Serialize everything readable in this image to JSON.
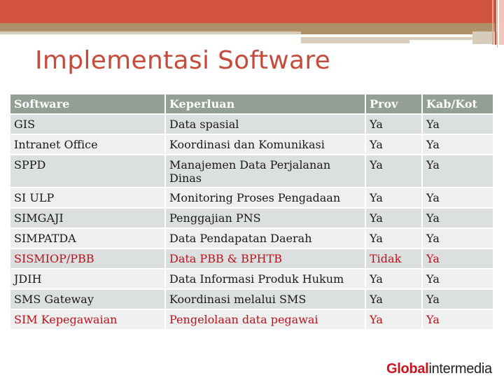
{
  "slide": {
    "title": "Implementasi Software",
    "accent_color": "#d2533d",
    "band_color": "#ae9169"
  },
  "table": {
    "columns": [
      "Software",
      "Keperluan",
      "Prov",
      "Kab/Kot"
    ],
    "rows": [
      {
        "software": "GIS",
        "keperluan": "Data spasial",
        "prov": "Ya",
        "kab": "Ya",
        "highlight": false
      },
      {
        "software": "Intranet Office",
        "keperluan": "Koordinasi dan Komunikasi",
        "prov": "Ya",
        "kab": "Ya",
        "highlight": false
      },
      {
        "software": "SPPD",
        "keperluan": "Manajemen Data Perjalanan Dinas",
        "prov": "Ya",
        "kab": "Ya",
        "highlight": false
      },
      {
        "software": "SI ULP",
        "keperluan": "Monitoring Proses Pengadaan",
        "prov": "Ya",
        "kab": "Ya",
        "highlight": false
      },
      {
        "software": "SIMGAJI",
        "keperluan": "Penggajian PNS",
        "prov": "Ya",
        "kab": "Ya",
        "highlight": false
      },
      {
        "software": "SIMPATDA",
        "keperluan": "Data Pendapatan Daerah",
        "prov": "Ya",
        "kab": "Ya",
        "highlight": false
      },
      {
        "software": "SISMIOP/PBB",
        "keperluan": "Data PBB & BPHTB",
        "prov": "Tidak",
        "kab": "Ya",
        "highlight": true
      },
      {
        "software": "JDIH",
        "keperluan": "Data Informasi Produk Hukum",
        "prov": "Ya",
        "kab": "Ya",
        "highlight": false
      },
      {
        "software": "SMS Gateway",
        "keperluan": "Koordinasi melalui SMS",
        "prov": "Ya",
        "kab": "Ya",
        "highlight": false
      },
      {
        "software": "SIM Kepegawaian",
        "keperluan": "Pengelolaan data pegawai",
        "prov": "Ya",
        "kab": "Ya",
        "highlight": true
      }
    ],
    "highlight_color": "#c0111a"
  },
  "watermark": {
    "part1": "Global",
    "part2": "intermedia"
  }
}
